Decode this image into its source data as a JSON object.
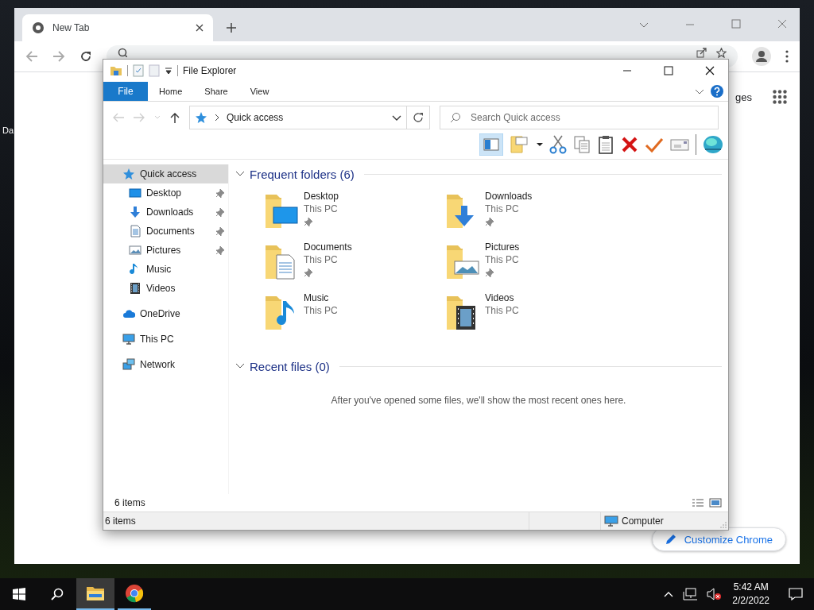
{
  "desktop": {
    "icon_label": "Da"
  },
  "browser": {
    "tab": {
      "title": "New Tab",
      "selected": true
    },
    "page": {
      "link_fragment": "ges",
      "customize_button": "Customize Chrome"
    }
  },
  "explorer": {
    "window": {
      "title": "File Explorer"
    },
    "ribbon": {
      "file_button": "File",
      "tabs": [
        {
          "label": "Home",
          "selected": false
        },
        {
          "label": "Share",
          "selected": false
        },
        {
          "label": "View",
          "selected": false
        }
      ]
    },
    "address": {
      "location": "Quick access"
    },
    "search": {
      "placeholder": "Search Quick access"
    },
    "sidebar": {
      "items": [
        {
          "label": "Quick access",
          "kind": "star",
          "selected": true,
          "children": [
            {
              "label": "Desktop",
              "kind": "desktop",
              "pinned": true,
              "selected": false
            },
            {
              "label": "Downloads",
              "kind": "downloads",
              "pinned": true,
              "selected": false
            },
            {
              "label": "Documents",
              "kind": "documents",
              "pinned": true,
              "selected": false
            },
            {
              "label": "Pictures",
              "kind": "pictures",
              "pinned": true,
              "selected": false
            },
            {
              "label": "Music",
              "kind": "music",
              "pinned": false,
              "selected": false
            },
            {
              "label": "Videos",
              "kind": "videos",
              "pinned": false,
              "selected": false
            }
          ]
        },
        {
          "label": "OneDrive",
          "kind": "cloud",
          "selected": false
        },
        {
          "label": "This PC",
          "kind": "pc",
          "selected": false
        },
        {
          "label": "Network",
          "kind": "network",
          "selected": false
        }
      ]
    },
    "frequent": {
      "title": "Frequent folders (6)",
      "expanded": true,
      "folders": [
        {
          "name": "Desktop",
          "location": "This PC",
          "kind": "desktop",
          "pinned": true
        },
        {
          "name": "Downloads",
          "location": "This PC",
          "kind": "downloads",
          "pinned": true
        },
        {
          "name": "Documents",
          "location": "This PC",
          "kind": "documents",
          "pinned": true
        },
        {
          "name": "Pictures",
          "location": "This PC",
          "kind": "pictures",
          "pinned": true
        },
        {
          "name": "Music",
          "location": "This PC",
          "kind": "music",
          "pinned": false
        },
        {
          "name": "Videos",
          "location": "This PC",
          "kind": "videos",
          "pinned": false
        }
      ]
    },
    "recent": {
      "title": "Recent files (0)",
      "expanded": true,
      "empty_message": "After you've opened some files, we'll show the most recent ones here."
    },
    "footer": {
      "item_count": "6 items"
    },
    "status_bar": {
      "item_count": "6 items",
      "location": "Computer"
    }
  },
  "taskbar": {
    "time": "5:42 AM",
    "date": "2/2/2022"
  }
}
